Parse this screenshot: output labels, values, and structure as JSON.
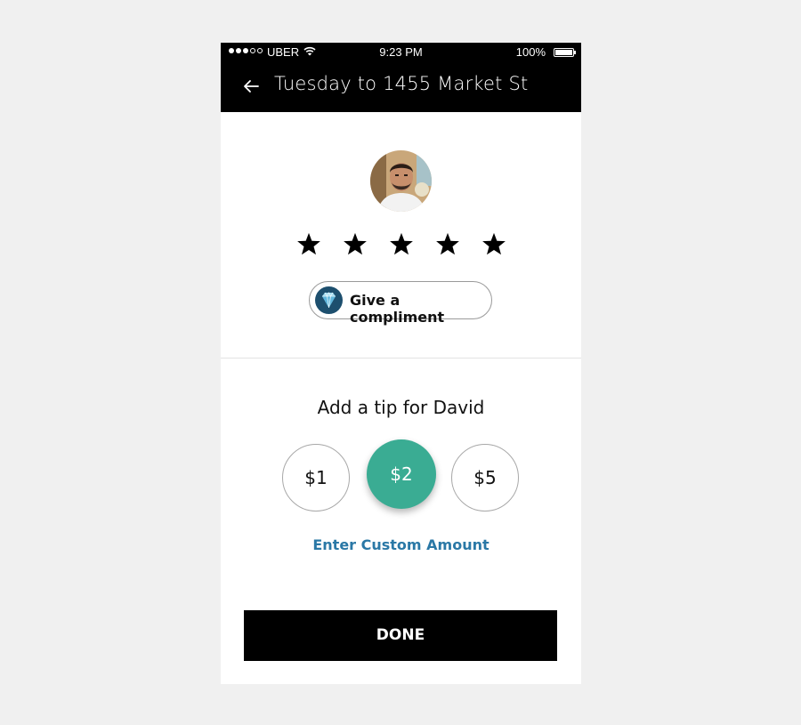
{
  "status_bar": {
    "carrier": "UBER",
    "time": "9:23 PM",
    "battery": "100%"
  },
  "nav": {
    "title": "Tuesday to 1455 Market St"
  },
  "rating": {
    "stars_filled": 5,
    "stars_total": 5
  },
  "compliment": {
    "label": "Give a compliment"
  },
  "tip": {
    "heading": "Add a tip for David",
    "options": [
      "$1",
      "$2",
      "$5"
    ],
    "selected": "$2",
    "custom_label": "Enter Custom Amount"
  },
  "done_label": "DONE",
  "colors": {
    "accent": "#3aac93",
    "link": "#2a78a6"
  }
}
